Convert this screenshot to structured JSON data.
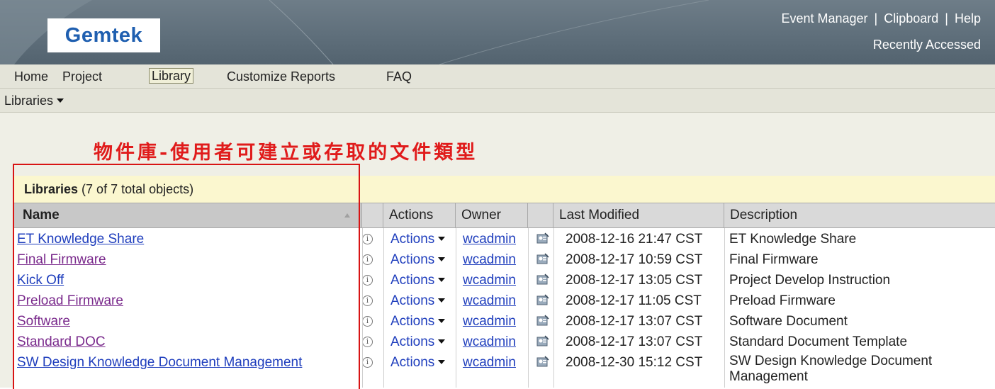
{
  "header": {
    "logo": "Gemtek",
    "links": [
      "Event Manager",
      "Clipboard",
      "Help"
    ],
    "separator": "|",
    "recently_accessed": "Recently Accessed"
  },
  "tabs": [
    {
      "label": "Home",
      "active": false
    },
    {
      "label": "Project",
      "active": false
    },
    {
      "label": "Library",
      "active": true
    },
    {
      "label": "Customize Reports",
      "active": false
    },
    {
      "label": "FAQ",
      "active": false
    }
  ],
  "subnav": {
    "label": "Libraries"
  },
  "annotation": "物件庫-使用者可建立或存取的文件類型",
  "table": {
    "title_bold": "Libraries",
    "title_rest": " (7 of 7 total objects)",
    "columns": {
      "name": "Name",
      "actions": "Actions",
      "owner": "Owner",
      "last_modified": "Last Modified",
      "description": "Description"
    },
    "rows": [
      {
        "name": "ET Knowledge Share",
        "visited": false,
        "actions": "Actions",
        "owner": "wcadmin",
        "modified": "2008-12-16 21:47 CST",
        "description": "ET Knowledge Share"
      },
      {
        "name": "Final Firmware",
        "visited": true,
        "actions": "Actions",
        "owner": "wcadmin",
        "modified": "2008-12-17 10:59 CST",
        "description": "Final Firmware"
      },
      {
        "name": "Kick Off",
        "visited": false,
        "actions": "Actions",
        "owner": "wcadmin",
        "modified": "2008-12-17 13:05 CST",
        "description": "Project Develop Instruction"
      },
      {
        "name": "Preload Firmware",
        "visited": true,
        "actions": "Actions",
        "owner": "wcadmin",
        "modified": "2008-12-17 11:05 CST",
        "description": "Preload Firmware"
      },
      {
        "name": "Software",
        "visited": true,
        "actions": "Actions",
        "owner": "wcadmin",
        "modified": "2008-12-17 13:07 CST",
        "description": "Software Document"
      },
      {
        "name": "Standard DOC",
        "visited": true,
        "actions": "Actions",
        "owner": "wcadmin",
        "modified": "2008-12-17 13:07 CST",
        "description": "Standard Document Template"
      },
      {
        "name": "SW Design Knowledge Document Management",
        "visited": false,
        "actions": "Actions",
        "owner": "wcadmin",
        "modified": "2008-12-30 15:12 CST",
        "description": "SW Design Knowledge Document Management"
      }
    ]
  },
  "icons": {
    "info": "info-icon",
    "owner_card": "user-card-icon",
    "dropdown": "caret-down-icon",
    "sort": "sort-ascending-icon"
  },
  "colors": {
    "banner": "#5f6f7b",
    "nav_bg": "#e4e4d9",
    "link": "#1f3ebd",
    "visited_link": "#7a2a8c",
    "annotation": "#e01b1b",
    "table_title_bg": "#fbf7cf"
  }
}
